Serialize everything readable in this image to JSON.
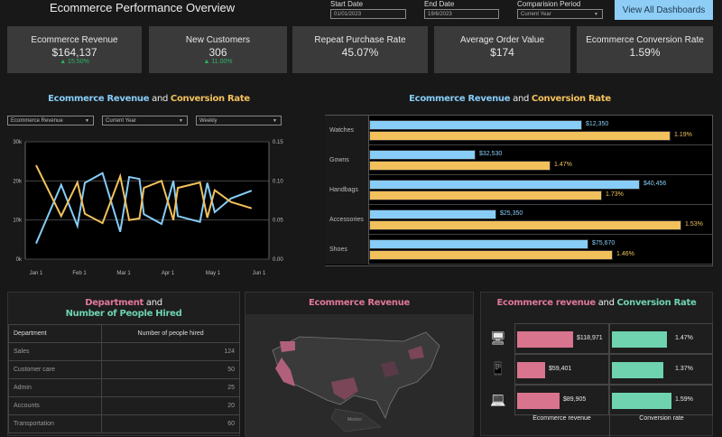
{
  "header": {
    "title": "Ecommerce Performance Overview",
    "start_label": "Start Date",
    "start_value": "01/01/2023",
    "end_label": "End Date",
    "end_value": "19/6/2023",
    "comparison_label": "Comparision Period",
    "comparison_value": "Current Year",
    "view_all": "View All Dashboards"
  },
  "kpis": [
    {
      "label": "Ecommerce Revenue",
      "value": "$164,137",
      "delta": "▲ 15.50%"
    },
    {
      "label": "New Customers",
      "value": "306",
      "delta": "▲ 11.00%"
    },
    {
      "label": "Repeat Purchase Rate",
      "value": "45.07%"
    },
    {
      "label": "Average Order Value",
      "value": "$174"
    },
    {
      "label": "Ecommerce Conversion Rate",
      "value": "1.59%"
    }
  ],
  "line_panel": {
    "title_a": "Ecommerce Revenue",
    "title_and": " and ",
    "title_b": "Conversion Rate",
    "dropdowns": [
      "Ecommerce Revenue",
      "Current  Year",
      "Weekly"
    ]
  },
  "bar_panel": {
    "title_a": "Ecommerce Revenue",
    "title_and": " and ",
    "title_b": "Conversion Rate"
  },
  "colors": {
    "blue": "#87cdf7",
    "yellow": "#f2c15c",
    "pink": "#d9748f",
    "green": "#6ed3ae",
    "button": "#8ecdf5",
    "positive": "#2fb36b"
  },
  "chart_data": [
    {
      "type": "line",
      "title": "Ecommerce Revenue and Conversion Rate",
      "x_ticks": [
        "Jan 1",
        "Feb 1",
        "Mar 1",
        "Apr 1",
        "May 1",
        "Jun 1"
      ],
      "y_left_ticks": [
        "0k",
        "10k",
        "20k",
        "30k"
      ],
      "y_left_range": [
        0,
        30000
      ],
      "y_right_ticks": [
        "0.00",
        "0.05",
        "0.10",
        "0.15"
      ],
      "y_right_range": [
        0,
        0.15
      ],
      "grid": true,
      "x": [
        "2023-01-01",
        "2023-01-18",
        "2023-01-29",
        "2023-02-03",
        "2023-02-15",
        "2023-02-27",
        "2023-03-05",
        "2023-03-12",
        "2023-03-15",
        "2023-03-27",
        "2023-04-04",
        "2023-04-07",
        "2023-04-22",
        "2023-04-27",
        "2023-05-02",
        "2023-05-13",
        "2023-05-27"
      ],
      "series": [
        {
          "axis": "left",
          "color": "#87cdf7",
          "values": [
            4000,
            19000,
            8500,
            19500,
            22000,
            7000,
            21000,
            20500,
            11500,
            9000,
            20000,
            11000,
            9500,
            19500,
            12000,
            15500,
            17500
          ]
        },
        {
          "axis": "right",
          "color": "#f2c15c",
          "values": [
            0.12,
            0.055,
            0.098,
            0.058,
            0.046,
            0.106,
            0.05,
            0.052,
            0.091,
            0.1,
            0.05,
            0.091,
            0.098,
            0.053,
            0.088,
            0.073,
            0.065
          ]
        }
      ]
    },
    {
      "type": "bar",
      "orientation": "horizontal",
      "title": "Ecommerce Revenue and Conversion Rate",
      "categories": [
        "Watches",
        "Gowns",
        "Handbags",
        "Accessories",
        "Shoes"
      ],
      "series": [
        {
          "color": "#87cdf7",
          "labels": [
            "$12,350",
            "$32,530",
            "$40,456",
            "$25,350",
            "$75,670"
          ],
          "values": [
            12350,
            32530,
            40456,
            25350,
            75670
          ],
          "display_level": [
            0.62,
            0.31,
            0.79,
            0.37,
            0.64
          ]
        },
        {
          "color": "#f2c15c",
          "labels": [
            "1.19%",
            "1.47%",
            "1.73%",
            "1.53%",
            "1.46%"
          ],
          "values": [
            1.19,
            1.47,
            1.73,
            1.53,
            1.46
          ],
          "display_level": [
            0.88,
            0.53,
            0.68,
            0.91,
            0.71
          ]
        }
      ]
    },
    {
      "type": "bar",
      "orientation": "horizontal",
      "title": "Ecommerce revenue and Conversion Rate",
      "categories": [
        "desktop",
        "mobile",
        "laptop"
      ],
      "icons": [
        "desktop-icon",
        "mobile-icon",
        "laptop-icon"
      ],
      "columns": [
        "Ecommerce revenue",
        "Conversion rate"
      ],
      "series": [
        {
          "name": "Ecommerce revenue",
          "color": "#d9748f",
          "labels": [
            "$118,971",
            "$59,401",
            "$89,905"
          ],
          "values": [
            118971,
            59401,
            89905
          ]
        },
        {
          "name": "Conversion rate",
          "color": "#6ed3ae",
          "labels": [
            "1.47%",
            "1.37%",
            "1.59%"
          ],
          "values": [
            1.47,
            1.37,
            1.59
          ]
        }
      ]
    }
  ],
  "table_panel": {
    "title_a": "Department",
    "title_and": " and ",
    "title_b": "Number of People Hired",
    "headers": [
      "Department",
      "Number of people hired"
    ],
    "rows": [
      [
        "Sales",
        "124"
      ],
      [
        "Customer care",
        "50"
      ],
      [
        "Admin",
        "25"
      ],
      [
        "Accounts",
        "20"
      ],
      [
        "Transportation",
        "60"
      ]
    ]
  },
  "map_panel": {
    "title": "Ecommerce Revenue",
    "label": "Mexico"
  },
  "device_panel": {
    "title_a": "Ecommerce revenue",
    "title_and": " and ",
    "title_b": "Conversion Rate"
  }
}
